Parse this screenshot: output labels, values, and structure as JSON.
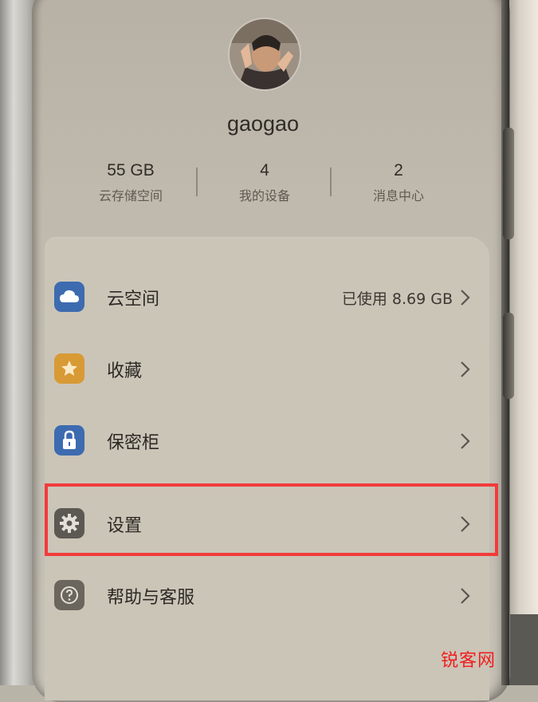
{
  "profile": {
    "username": "gaogao"
  },
  "stats": [
    {
      "value": "55 GB",
      "label": "云存储空间"
    },
    {
      "value": "4",
      "label": "我的设备"
    },
    {
      "value": "2",
      "label": "消息中心"
    }
  ],
  "menu": [
    {
      "label": "云空间",
      "value": "已使用 8.69 GB",
      "icon": "cloud-icon",
      "color": "#3d6bb0"
    },
    {
      "label": "收藏",
      "value": "",
      "icon": "star-icon",
      "color": "#d89a34"
    },
    {
      "label": "保密柜",
      "value": "",
      "icon": "lock-icon",
      "color": "#3d6bb0"
    },
    {
      "label": "设置",
      "value": "",
      "icon": "gear-icon",
      "color": "#5c5952"
    },
    {
      "label": "帮助与客服",
      "value": "",
      "icon": "help-icon",
      "color": "#6a665e"
    }
  ],
  "watermark": "锐客网",
  "colors": {
    "highlight": "#f23b3b",
    "watermark": "#f01e1e"
  }
}
